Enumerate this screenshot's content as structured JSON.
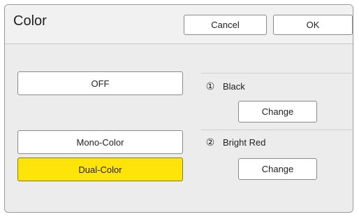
{
  "header": {
    "title": "Color",
    "cancel_label": "Cancel",
    "ok_label": "OK"
  },
  "modes": {
    "off_label": "OFF",
    "mono_label": "Mono-Color",
    "dual_label": "Dual-Color",
    "selected": "Dual-Color",
    "selected_color": "#ffe40a"
  },
  "drums": [
    {
      "number": "①",
      "color_name": "Black",
      "change_label": "Change"
    },
    {
      "number": "②",
      "color_name": "Bright Red",
      "change_label": "Change"
    }
  ]
}
